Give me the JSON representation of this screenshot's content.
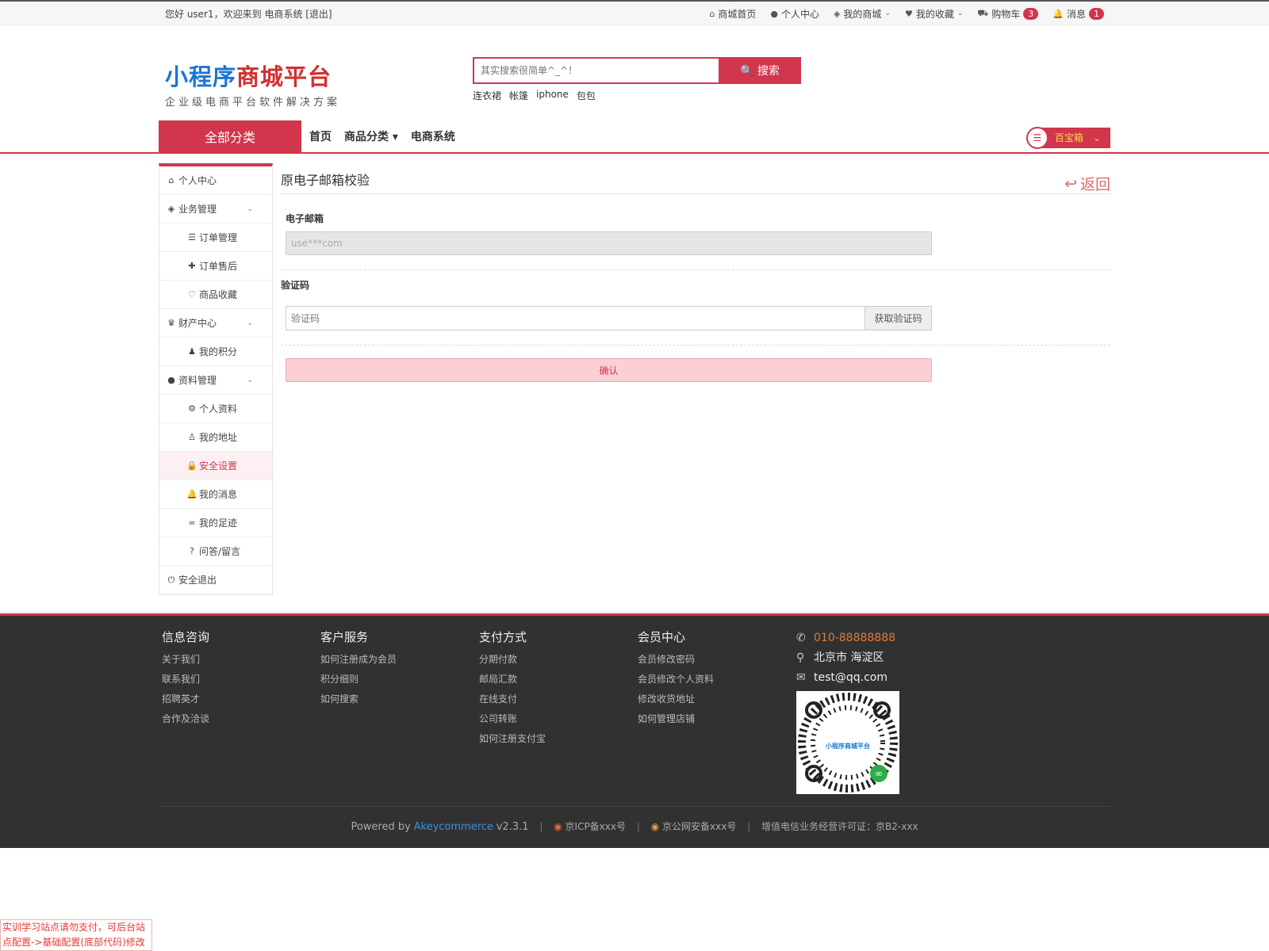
{
  "topbar": {
    "greeting": "您好 user1，欢迎来到 电商系统 [退出]",
    "nav": [
      {
        "icon": "home-icon",
        "glyph": "⌂",
        "label": "商城首页"
      },
      {
        "icon": "user-icon",
        "glyph": "●",
        "label": "个人中心"
      },
      {
        "icon": "cube-icon",
        "glyph": "◈",
        "label": "我的商城",
        "dropdown": true
      },
      {
        "icon": "heart-icon",
        "glyph": "♥",
        "label": "我的收藏",
        "dropdown": true
      },
      {
        "icon": "cart-icon",
        "glyph": "⛟",
        "label": "购物车",
        "badge": "3"
      },
      {
        "icon": "bell-icon",
        "glyph": "🔔",
        "label": "消息",
        "badge": "1"
      }
    ]
  },
  "logo": {
    "part1": "小程序",
    "part2": "商城平台",
    "tagline": "企业级电商平台软件解决方案"
  },
  "search": {
    "placeholder": "其实搜索很简单^_^！",
    "button": "搜索",
    "hotwords": [
      "连衣裙",
      "帐篷",
      "iphone",
      "包包"
    ]
  },
  "nav": {
    "all_categories": "全部分类",
    "links": [
      "首页",
      "商品分类",
      "电商系统"
    ],
    "treasure": "百宝箱"
  },
  "sidebar": [
    {
      "label": "个人中心",
      "icon": "home-icon",
      "glyph": "⌂",
      "sub": false
    },
    {
      "label": "业务管理",
      "icon": "cube-icon",
      "glyph": "◈",
      "sub": false,
      "expand": true
    },
    {
      "label": "订单管理",
      "icon": "list-icon",
      "glyph": "☰",
      "sub": true
    },
    {
      "label": "订单售后",
      "icon": "puzzle-icon",
      "glyph": "✚",
      "sub": true
    },
    {
      "label": "商品收藏",
      "icon": "heart-outline-icon",
      "glyph": "♡",
      "sub": true
    },
    {
      "label": "财产中心",
      "icon": "trophy-icon",
      "glyph": "♛",
      "sub": false,
      "expand": true
    },
    {
      "label": "我的积分",
      "icon": "chess-icon",
      "glyph": "♟",
      "sub": true
    },
    {
      "label": "资料管理",
      "icon": "user-icon",
      "glyph": "●",
      "sub": false,
      "expand": true
    },
    {
      "label": "个人资料",
      "icon": "gear-icon",
      "glyph": "⚙",
      "sub": true
    },
    {
      "label": "我的地址",
      "icon": "street-view-icon",
      "glyph": "♙",
      "sub": true
    },
    {
      "label": "安全设置",
      "icon": "lock-icon",
      "glyph": "🔒",
      "sub": true,
      "active": true
    },
    {
      "label": "我的消息",
      "icon": "bell-outline-icon",
      "glyph": "🔔",
      "sub": true
    },
    {
      "label": "我的足迹",
      "icon": "glasses-icon",
      "glyph": "∞",
      "sub": true
    },
    {
      "label": "问答/留言",
      "icon": "question-icon",
      "glyph": "?",
      "sub": true
    },
    {
      "label": "安全退出",
      "icon": "power-icon",
      "glyph": "⏻",
      "sub": false
    }
  ],
  "page": {
    "title": "原电子邮箱校验",
    "back": "返回",
    "email_label": "电子邮箱",
    "email_value": "use***com",
    "code_label": "验证码",
    "code_placeholder": "验证码",
    "get_code": "获取验证码",
    "confirm": "确认"
  },
  "footer": {
    "columns": [
      {
        "title": "信息咨询",
        "links": [
          "关于我们",
          "联系我们",
          "招聘英才",
          "合作及洽谈"
        ]
      },
      {
        "title": "客户服务",
        "links": [
          "如何注册成为会员",
          "积分细则",
          "如何搜索"
        ]
      },
      {
        "title": "支付方式",
        "links": [
          "分期付款",
          "邮局汇款",
          "在线支付",
          "公司转账",
          "如何注册支付宝"
        ]
      },
      {
        "title": "会员中心",
        "links": [
          "会员修改密码",
          "会员修改个人资料",
          "修改收货地址",
          "如何管理店铺"
        ]
      }
    ],
    "phone": "010-88888888",
    "address": "北京市 海淀区",
    "email": "test@qq.com",
    "qr_text": "小程序商城平台",
    "powered_prefix": "Powered by",
    "powered_brand": "Akeycommerce",
    "version": "v2.3.1",
    "icp": "京ICP备xxx号",
    "police": "京公网安备xxx号",
    "license": "增值电信业务经营许可证：京B2-xxx"
  },
  "notice": "实训学习站点请勿支付，可后台站点配置->基础配置(底部代码)修改",
  "colors": {
    "primary": "#d2364c",
    "footer_bg": "#313131",
    "phone": "#e07b39",
    "brand_blue": "#3d8fe0"
  }
}
